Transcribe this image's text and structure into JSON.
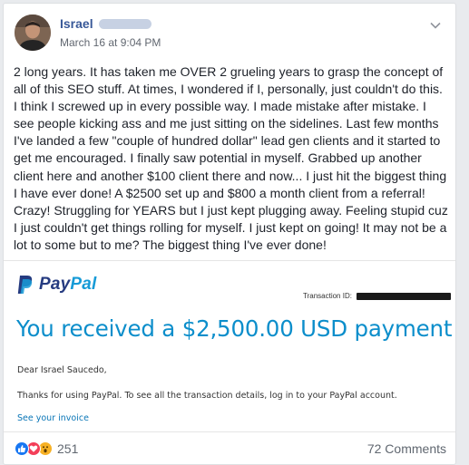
{
  "post": {
    "author_name": "Israel",
    "timestamp": "March 16 at 9:04 PM",
    "text": "2 long years. It has taken me OVER 2 grueling years to grasp the concept of all of this SEO stuff. At times, I wondered if I, personally, just couldn't do this. I think I screwed up in every possible way. I made mistake after mistake. I see people kicking ass and me just sitting on the sidelines. Last few months I've landed a few \"couple of hundred dollar\" lead gen clients and it started to get me encouraged. I finally saw potential in myself. Grabbed up another client here and another $100 client there and now... I just hit the biggest thing I have ever done! A $2500 set up and $800 a month client from a referral! Crazy! Struggling for YEARS but I just kept plugging away. Feeling stupid cuz I just couldn't get things rolling for myself. I just kept on going! It may not be a lot to some but to me? The biggest thing I've ever done!"
  },
  "attachment": {
    "logo_text_1": "Pay",
    "logo_text_2": "Pal",
    "transaction_label": "Transaction ID:",
    "headline": "You received a $2,500.00 USD payment",
    "greeting": "Dear Israel Saucedo,",
    "body": "Thanks for using PayPal. To see all the transaction details, log in to your PayPal account.",
    "link": "See your invoice"
  },
  "footer": {
    "reaction_count": "251",
    "comments": "72 Comments",
    "reaction_icons": [
      "like-icon",
      "love-icon",
      "wow-icon"
    ]
  },
  "colors": {
    "author": "#385898",
    "paypal_dark": "#253b80",
    "paypal_light": "#179bd7",
    "headline": "#0c8ecb"
  }
}
